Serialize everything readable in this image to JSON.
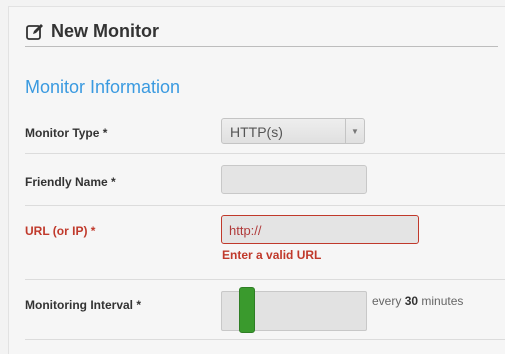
{
  "header": {
    "title": "New Monitor",
    "icon": "edit-icon"
  },
  "section": {
    "title": "Monitor Information"
  },
  "fields": {
    "monitor_type": {
      "label": "Monitor Type *",
      "value": "HTTP(s)"
    },
    "friendly_name": {
      "label": "Friendly Name *",
      "value": ""
    },
    "url": {
      "label": "URL (or IP) *",
      "placeholder": "http://",
      "error": "Enter a valid URL"
    },
    "interval": {
      "label": "Monitoring Interval *",
      "prefix": "every",
      "value": "30",
      "suffix": "minutes"
    }
  },
  "colors": {
    "accent": "#3a9ae0",
    "error": "#c0392b",
    "slider_handle": "#3a9a2d"
  }
}
